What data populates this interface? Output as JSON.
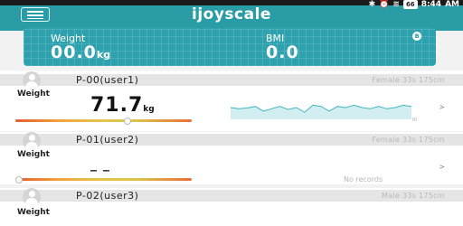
{
  "statusbar": {
    "time": "8:44",
    "ampm": "AM",
    "battery": "66"
  },
  "app": {
    "title": "ijoyscale"
  },
  "panel": {
    "weight_label": "Weight",
    "weight_value": "00.0",
    "weight_unit": "kg",
    "bmi_label": "BMI",
    "bmi_value": "0.0"
  },
  "users": [
    {
      "name": "P-00(user1)",
      "info": "Female 33s 175cm",
      "weight_label": "Weight",
      "weight_value": "71.7",
      "weight_unit": "kg",
      "chart_unit": "In",
      "trend": [
        0.5,
        0.45,
        0.48,
        0.55,
        0.35,
        0.45,
        0.55,
        0.42,
        0.5,
        0.3,
        0.6,
        0.55,
        0.35,
        0.55,
        0.5,
        0.6,
        0.5,
        0.45,
        0.55,
        0.45,
        0.5,
        0.6,
        0.55
      ]
    },
    {
      "name": "P-01(user2)",
      "info": "Female 33s 175cm",
      "weight_label": "Weight",
      "weight_value": "_ _",
      "no_records": "No records"
    },
    {
      "name": "P-02(user3)",
      "info": "Male 33s 175cm",
      "weight_label": "Weight"
    }
  ],
  "colors": {
    "accent": "#2a9ca6",
    "panel": "#2da2ae",
    "chart": "#3fb6c0"
  }
}
